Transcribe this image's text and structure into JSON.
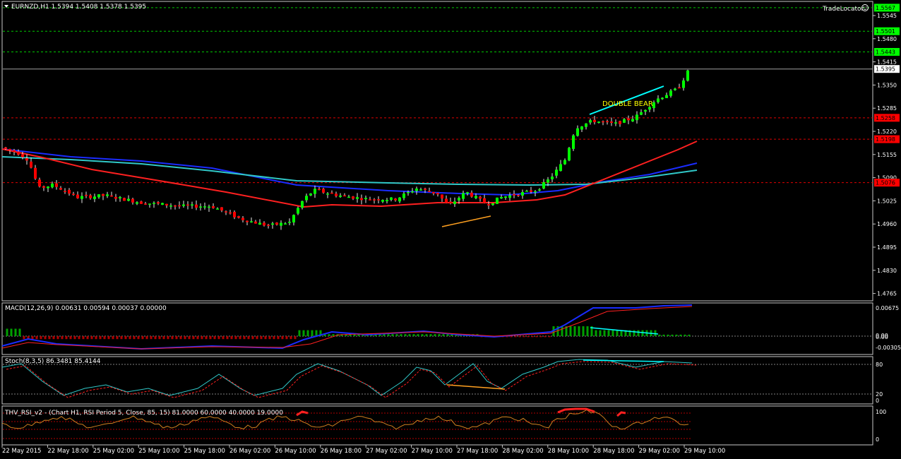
{
  "main_panel": {
    "header": "EURNZD,H1  1.5394 1.5408 1.5378 1.5395",
    "indicator_name": "TradeLocator",
    "price_ticks": [
      "1.5545",
      "1.5480",
      "1.5415",
      "1.5350",
      "1.5285",
      "1.5220",
      "1.5155",
      "1.5090",
      "1.5025",
      "1.4960",
      "1.4895",
      "1.4830",
      "1.4765"
    ],
    "price_tags": [
      {
        "label": "1.5567",
        "price": 1.5567,
        "color": "#00ff00",
        "text_color": "#000000",
        "line": "dash-green"
      },
      {
        "label": "1.5501",
        "price": 1.5501,
        "color": "#00ff00",
        "text_color": "#000000",
        "line": "dash-green"
      },
      {
        "label": "1.5443",
        "price": 1.5443,
        "color": "#00ff00",
        "text_color": "#000000",
        "line": "dash-green"
      },
      {
        "label": "1.5395",
        "price": 1.5395,
        "color": "#ffffff",
        "text_color": "#000000",
        "line": "solid-grey"
      },
      {
        "label": "1.5258",
        "price": 1.5258,
        "color": "#ff0000",
        "text_color": "#000000",
        "line": "dash-red"
      },
      {
        "label": "1.5198",
        "price": 1.5198,
        "color": "#ff0000",
        "text_color": "#000000",
        "line": "dash-red"
      },
      {
        "label": "1.5076",
        "price": 1.5076,
        "color": "#ff0000",
        "text_color": "#000000",
        "line": "dash-red"
      }
    ],
    "annotation": "DOUBLE BEAR",
    "colors": {
      "bull": "#00ff00",
      "bear": "#ff0000",
      "ma_fast": "#ff2020",
      "ma_mid": "#1a2cff",
      "ma_slow": "#30c8c8",
      "divergence_bear": "#00ffff",
      "divergence_bull": "#ffa020"
    }
  },
  "macd_panel": {
    "header": "MACD(12,26,9) 0.00631 0.00594 0.00037 0.00000",
    "ticks": [
      "0.00675",
      "0.00",
      "0.00",
      "-0.00305"
    ]
  },
  "stoch_panel": {
    "header": "Stoch(8,3,5) 86.3481 85.4144",
    "ticks": [
      "80",
      "20",
      "0"
    ]
  },
  "rsi_panel": {
    "header": "THV_RSI_v2 - (Chart H1,  RSI Period 5,  Close,  85,  15)  81.0000 60.0000 40.0000 19.0000",
    "ticks": [
      "100",
      "0"
    ]
  },
  "time_axis": {
    "labels": [
      "22 May 2015",
      "22 May 18:00",
      "25 May 02:00",
      "25 May 10:00",
      "25 May 18:00",
      "26 May 02:00",
      "26 May 10:00",
      "26 May 18:00",
      "27 May 02:00",
      "27 May 10:00",
      "27 May 18:00",
      "28 May 02:00",
      "28 May 10:00",
      "28 May 18:00",
      "29 May 02:00",
      "29 May 10:00"
    ]
  }
}
